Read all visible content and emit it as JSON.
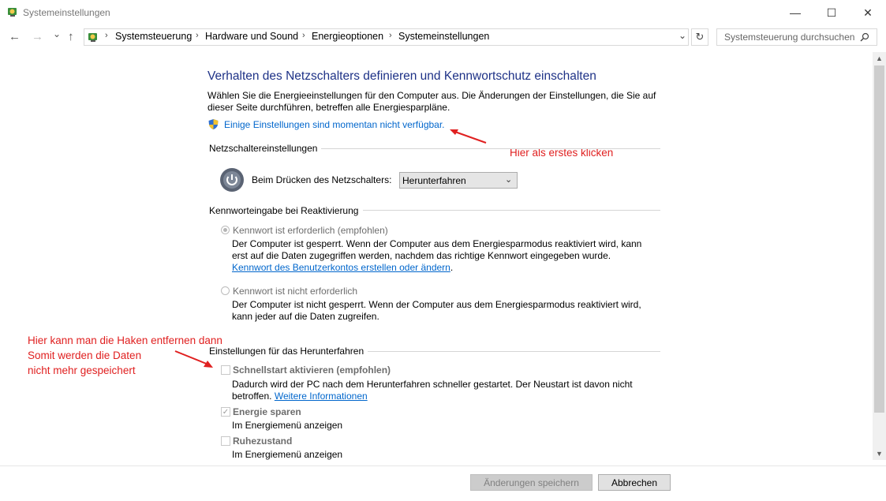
{
  "window": {
    "title": "Systemeinstellungen",
    "minimize": "—",
    "maximize": "☐",
    "close": "✕"
  },
  "nav": {
    "back": "←",
    "forward": "→",
    "recent": "⌄",
    "up": "↑",
    "breadcrumb": [
      "Systemsteuerung",
      "Hardware und Sound",
      "Energieoptionen",
      "Systemeinstellungen"
    ],
    "breadcrumb_sep": "›",
    "dropdown": "⌄",
    "refresh": "↻",
    "search_placeholder": "Systemsteuerung durchsuchen"
  },
  "content": {
    "heading": "Verhalten des Netzschalters definieren und Kennwortschutz einschalten",
    "intro": "Wählen Sie die Energieeinstellungen für den Computer aus. Die Änderungen der Einstellungen, die Sie auf dieser Seite durchführen, betreffen alle Energiesparpläne.",
    "unavailable_link": "Einige Einstellungen sind momentan nicht verfügbar.",
    "power_section": {
      "title": "Netzschaltereinstellungen",
      "label": "Beim Drücken des Netzschalters:",
      "selected": "Herunterfahren"
    },
    "password_section": {
      "title": "Kennworteingabe bei Reaktivierung",
      "option1_label": "Kennwort ist erforderlich (empfohlen)",
      "option1_text": "Der Computer ist gesperrt. Wenn der Computer aus dem Energiesparmodus reaktiviert wird, kann erst auf die Daten zugegriffen werden, nachdem das richtige Kennwort eingegeben wurde.",
      "option1_link": "Kennwort des Benutzerkontos erstellen oder ändern",
      "option1_link_suffix": ".",
      "option2_label": "Kennwort ist nicht erforderlich",
      "option2_text": "Der Computer ist nicht gesperrt. Wenn der Computer aus dem Energiesparmodus reaktiviert wird, kann jeder auf die Daten zugreifen."
    },
    "shutdown_section": {
      "title": "Einstellungen für das Herunterfahren",
      "fast_label": "Schnellstart aktivieren (empfohlen)",
      "fast_text": "Dadurch wird der PC nach dem Herunterfahren schneller gestartet. Der Neustart ist davon nicht betroffen.",
      "fast_link": "Weitere Informationen",
      "sleep_label": "Energie sparen",
      "sleep_text": "Im Energiemenü anzeigen",
      "hibernate_label": "Ruhezustand",
      "hibernate_text": "Im Energiemenü anzeigen"
    }
  },
  "annotations": {
    "first_click": "Hier als erstes klicken",
    "remove_checks": [
      "Hier kann man die Haken entfernen dann",
      "Somit werden die Daten",
      "nicht mehr gespeichert"
    ]
  },
  "buttons": {
    "save": "Änderungen speichern",
    "cancel": "Abbrechen"
  },
  "colors": {
    "heading": "#1e3287",
    "link": "#0066cc",
    "annotation": "#e02020"
  }
}
